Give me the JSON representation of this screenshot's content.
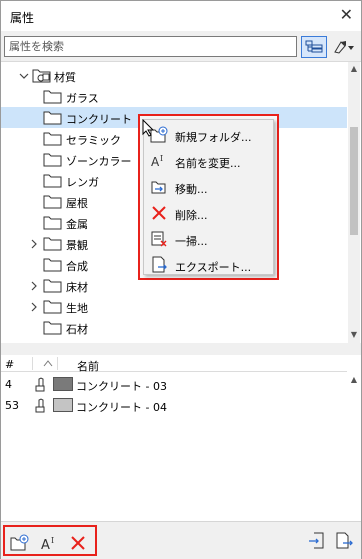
{
  "window": {
    "title": "属性",
    "close_glyph": "✕"
  },
  "search": {
    "placeholder": "属性を検索"
  },
  "tree": {
    "root": {
      "label": "材質",
      "expanded": true
    },
    "items": [
      {
        "label": "ガラス",
        "expandable": false,
        "selected": false
      },
      {
        "label": "コンクリート",
        "expandable": false,
        "selected": true
      },
      {
        "label": "セラミック",
        "expandable": false,
        "selected": false
      },
      {
        "label": "ゾーンカラー",
        "expandable": false,
        "selected": false
      },
      {
        "label": "レンガ",
        "expandable": false,
        "selected": false
      },
      {
        "label": "屋根",
        "expandable": false,
        "selected": false
      },
      {
        "label": "金属",
        "expandable": false,
        "selected": false
      },
      {
        "label": "景観",
        "expandable": true,
        "selected": false
      },
      {
        "label": "合成",
        "expandable": false,
        "selected": false
      },
      {
        "label": "床材",
        "expandable": true,
        "selected": false
      },
      {
        "label": "生地",
        "expandable": true,
        "selected": false
      },
      {
        "label": "石材",
        "expandable": false,
        "selected": false
      }
    ]
  },
  "context_menu": {
    "items": [
      {
        "label": "新規フォルダ...",
        "icon": "new-folder-icon"
      },
      {
        "label": "名前を変更...",
        "icon": "rename-icon"
      },
      {
        "label": "移動...",
        "icon": "move-icon"
      },
      {
        "label": "削除...",
        "icon": "delete-icon"
      },
      {
        "label": "一掃...",
        "icon": "purge-icon"
      },
      {
        "label": "エクスポート...",
        "icon": "export-icon"
      }
    ]
  },
  "list": {
    "headers": {
      "index": "#",
      "name": "名前"
    },
    "rows": [
      {
        "index": "4",
        "name": "コンクリート - 03",
        "color": "#7a7a7a"
      },
      {
        "index": "53",
        "name": "コンクリート - 04",
        "color": "#c4c4c4"
      }
    ]
  },
  "colors": {
    "highlight": "#e8211b",
    "selection": "#cde4fa",
    "accent": "#3b7bd8"
  }
}
